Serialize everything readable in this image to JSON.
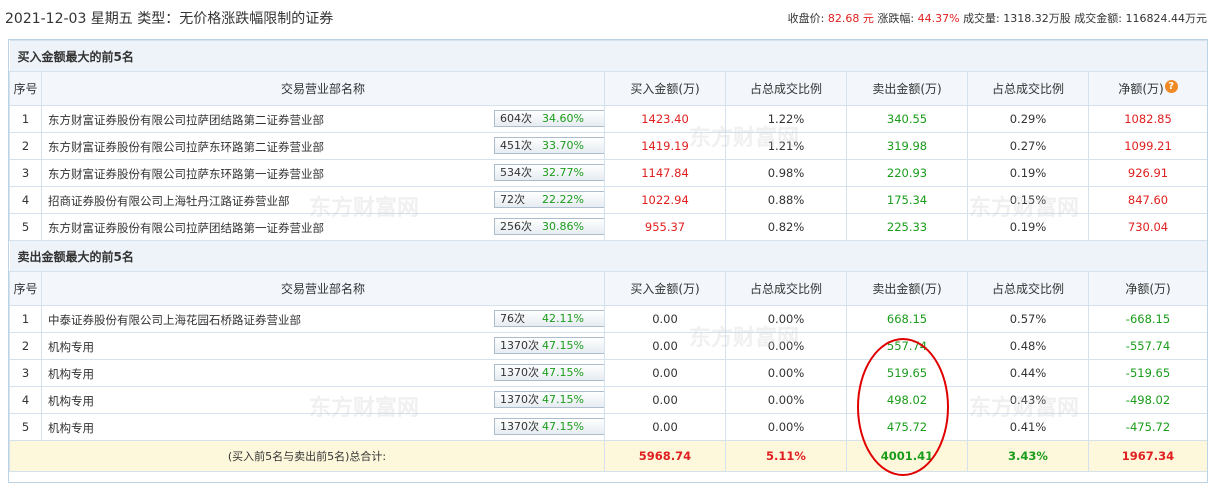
{
  "header": {
    "title": "2021-12-03 星期五 类型：无价格涨跌幅限制的证券",
    "close_label": "收盘价:",
    "close_value": "82.68 元",
    "change_label": "涨跌幅:",
    "change_value": "44.37%",
    "volume_label": "成交量:",
    "volume_value": "1318.32万股",
    "amount_label": "成交金额:",
    "amount_value": "116824.44万元"
  },
  "columns": [
    "序号",
    "交易营业部名称",
    "买入金额(万)",
    "占总成交比例",
    "卖出金额(万)",
    "占总成交比例",
    "净额(万)"
  ],
  "watermark": "东方财富网",
  "buy_section": {
    "title": "买入金额最大的前5名",
    "rows": [
      {
        "no": "1",
        "name": "东方财富证券股份有限公司拉萨团结路第二证券营业部",
        "times": "604次",
        "pct": "34.60%",
        "buy": "1423.40",
        "buy_ratio": "1.22%",
        "sell": "340.55",
        "sell_ratio": "0.29%",
        "net": "1082.85",
        "icon": "question-icon"
      },
      {
        "no": "2",
        "name": "东方财富证券股份有限公司拉萨东环路第二证券营业部",
        "times": "451次",
        "pct": "33.70%",
        "buy": "1419.19",
        "buy_ratio": "1.21%",
        "sell": "319.98",
        "sell_ratio": "0.27%",
        "net": "1099.21",
        "icon": "arrow-right-icon"
      },
      {
        "no": "3",
        "name": "东方财富证券股份有限公司拉萨东环路第一证券营业部",
        "times": "534次",
        "pct": "32.77%",
        "buy": "1147.84",
        "buy_ratio": "0.98%",
        "sell": "220.93",
        "sell_ratio": "0.19%",
        "net": "926.91",
        "icon": "arrow-right-icon"
      },
      {
        "no": "4",
        "name": "招商证券股份有限公司上海牡丹江路证券营业部",
        "times": "72次",
        "pct": "22.22%",
        "buy": "1022.94",
        "buy_ratio": "0.88%",
        "sell": "175.34",
        "sell_ratio": "0.15%",
        "net": "847.60",
        "icon": "arrow-right-icon"
      },
      {
        "no": "5",
        "name": "东方财富证券股份有限公司拉萨团结路第一证券营业部",
        "times": "256次",
        "pct": "30.86%",
        "buy": "955.37",
        "buy_ratio": "0.82%",
        "sell": "225.33",
        "sell_ratio": "0.19%",
        "net": "730.04",
        "icon": "arrow-right-icon"
      }
    ]
  },
  "sell_section": {
    "title": "卖出金额最大的前5名",
    "rows": [
      {
        "no": "1",
        "name": "中泰证券股份有限公司上海花园石桥路证券营业部",
        "times": "76次",
        "pct": "42.11%",
        "buy": "0.00",
        "buy_ratio": "0.00%",
        "sell": "668.15",
        "sell_ratio": "0.57%",
        "net": "-668.15",
        "icon": "question-icon"
      },
      {
        "no": "2",
        "name": "机构专用",
        "times": "1370次",
        "pct": "47.15%",
        "buy": "0.00",
        "buy_ratio": "0.00%",
        "sell": "557.74",
        "sell_ratio": "0.48%",
        "net": "-557.74",
        "icon": "arrow-right-icon"
      },
      {
        "no": "3",
        "name": "机构专用",
        "times": "1370次",
        "pct": "47.15%",
        "buy": "0.00",
        "buy_ratio": "0.00%",
        "sell": "519.65",
        "sell_ratio": "0.44%",
        "net": "-519.65",
        "icon": "arrow-right-icon"
      },
      {
        "no": "4",
        "name": "机构专用",
        "times": "1370次",
        "pct": "47.15%",
        "buy": "0.00",
        "buy_ratio": "0.00%",
        "sell": "498.02",
        "sell_ratio": "0.43%",
        "net": "-498.02",
        "icon": "arrow-right-icon"
      },
      {
        "no": "5",
        "name": "机构专用",
        "times": "1370次",
        "pct": "47.15%",
        "buy": "0.00",
        "buy_ratio": "0.00%",
        "sell": "475.72",
        "sell_ratio": "0.41%",
        "net": "-475.72",
        "icon": "arrow-right-icon"
      }
    ]
  },
  "total": {
    "label": "(买入前5名与卖出前5名)总合计:",
    "buy": "5968.74",
    "buy_ratio": "5.11%",
    "sell": "4001.41",
    "sell_ratio": "3.43%",
    "net": "1967.34"
  },
  "colors": {
    "up": "#e02020",
    "down": "#1a9c1a",
    "header_bg": "#eef3f9",
    "total_bg": "#fdf7dc",
    "annotation": "#e00000"
  }
}
